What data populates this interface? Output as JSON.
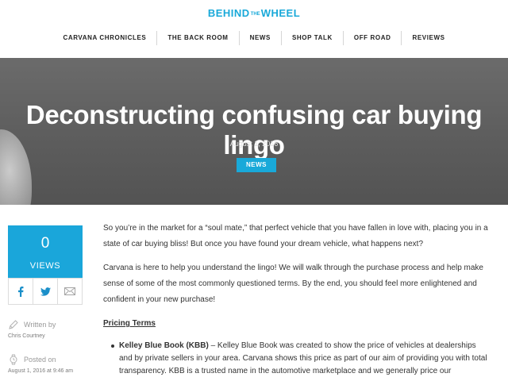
{
  "brand": {
    "name_left": "BEHIND",
    "name_small": "THE",
    "name_right": "WHEEL"
  },
  "nav": [
    {
      "label": "CARVANA CHRONICLES"
    },
    {
      "label": "THE BACK ROOM"
    },
    {
      "label": "NEWS"
    },
    {
      "label": "SHOP TALK"
    },
    {
      "label": "OFF ROAD"
    },
    {
      "label": "REVIEWS"
    }
  ],
  "hero": {
    "title": "Deconstructing confusing car buying lingo",
    "date": "August 1, 2016",
    "category": "NEWS"
  },
  "views": {
    "count": "0",
    "label": "VIEWS"
  },
  "share": {
    "icons": [
      "facebook-icon",
      "twitter-icon",
      "email-icon"
    ]
  },
  "meta": {
    "written_by_label": "Written by",
    "author": "Chris Courtney",
    "posted_on_label": "Posted on",
    "posted_at": "August 1, 2016 at 9:46 am"
  },
  "article": {
    "para1": "So you’re in the market for a “soul mate,” that perfect vehicle that you have fallen in love with, placing you in a state of car buying bliss! But once you have found your dream vehicle, what happens next?",
    "para2": "Carvana is here to help you understand the lingo! We will walk through the purchase process and help make sense of some of the most commonly questioned terms. By the end, you should feel more enlightened and confident in your new purchase!",
    "section_title": "Pricing Terms",
    "bullet1_term": "Kelley Blue Book (KBB)",
    "bullet1_text": " – Kelley Blue Book was created to show the price of vehicles at dealerships and by private sellers in your area. Carvana shows this price as part of our aim of providing you with total transparency. KBB is a trusted name in the automotive marketplace and we generally price our"
  },
  "colors": {
    "accent": "#19a9d9",
    "hero_bg": "#5f5f5f"
  }
}
